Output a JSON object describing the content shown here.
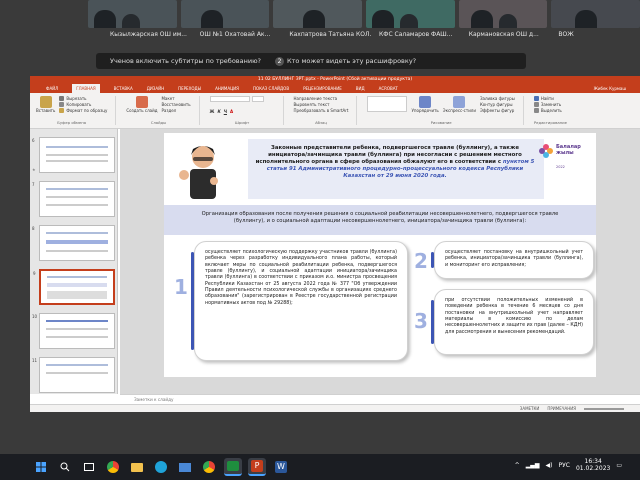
{
  "participants": {
    "names": [
      "Кызылжарская ОШ им...",
      "ОШ №1 Охатовай Ак...",
      "Кахпатрова Татьяна КОЛ...",
      "КФС Саламаров ФАШ...",
      "Кармановская ОШ д...",
      "ВОЖ"
    ],
    "caption_prompt": "Ученов включить субтитры по требованию?",
    "caption_num": "2",
    "caption_question": "Кто может видеть эту расшифровку?"
  },
  "window": {
    "title": "11 02 БУЛЛИНГ ЗРТ.pptx - PowerPoint (Сбой активации продукта)",
    "user": "Жибек Курмаш",
    "menu": [
      "ФАЙЛ",
      "ГЛАВНАЯ",
      "ВСТАВКА",
      "ДИЗАЙН",
      "ПЕРЕХОДЫ",
      "АНИМАЦИЯ",
      "ПОКАЗ СЛАЙДОВ",
      "РЕЦЕНЗИРОВАНИЕ",
      "ВИД",
      "ACROBAT"
    ],
    "ribbon": {
      "paste": "Вставить",
      "cut": "Вырезать",
      "copy": "Копировать",
      "format_painter": "Формат по образцу",
      "clipboard_label": "Буфер обмена",
      "new_slide": "Создать слайд",
      "layout": "Макет",
      "reset": "Восстановить",
      "section": "Раздел",
      "slides_label": "Слайды",
      "font_label": "Шрифт",
      "text_direction": "Направление текста",
      "align_text": "Выровнять текст",
      "smartart": "Преобразовать в SmartArt",
      "paragraph_label": "Абзац",
      "arrange": "Упорядочить",
      "quick_styles": "Экспресс-стили",
      "fill": "Заливка фигуры",
      "outline": "Контур фигуры",
      "effects": "Эффекты фигур",
      "drawing_label": "Рисование",
      "find": "Найти",
      "replace": "Заменить",
      "select": "Выделить",
      "editing_label": "Редактирование"
    }
  },
  "slide_numbers": [
    "6",
    "7",
    "8",
    "9",
    "10",
    "11"
  ],
  "slide": {
    "title_plain_1": "Законные представители ребенка, подвергшегося травле (буллингу), а также инициатора/зачинщика травли (буллинга) при несогласии с решением местного исполнительного органа в сфере образования обжалуют его в соответствии с ",
    "title_highlight": "пунктом 5 статьи 91 Административного процедурно-процессуального кодекса Республики Казахстан от 29 июня 2020 года.",
    "logo_line1": "Балалар",
    "logo_line2": "жылы",
    "logo_year": "2022",
    "banner": "Организация образования после получения решения о социальной реабилитации несовершеннолетнего, подвергшегося травле (буллингу), и о социальной адаптации несовершеннолетнего, инициатора/зачинщика травли (буллинга):",
    "num1": "1",
    "num2": "2",
    "num3": "3",
    "card1": "осуществляет психологическую поддержку участников травли (буллинга) ребенка через разработку индивидуального плана работы, который включает меры по социальной реабилитации ребенка, подвергшегося травле (буллингу), и социальной адаптации инициатора/зачинщика травли (буллинга) в соответствии с приказом и.о. министра просвещения Республики Казахстан от 25 августа 2022 года № 377 \"Об утверждении Правил деятельности психологической службы в организациях среднего образования\" (зарегистрирован в Реестре государственной регистрации нормативных актов под № 29288);",
    "card2": "осуществляет постановку на внутришкольный учет ребенка, инициатора/зачинщика травли (буллинга), и мониторинг его исправления;",
    "card3": "при отсутствии положительных изменений в поведении ребенка в течение 6 месяцев со дня постановки на внутришкольный учет направляет материалы в комиссию по делам несовершеннолетних и защите их прав (далее – КДН) для рассмотрения и вынесения рекомендаций."
  },
  "notes_placeholder": "Заметки к слайду",
  "status": {
    "notes": "ЗАМЕТКИ",
    "comments": "ПРИМЕЧАНИЯ"
  },
  "taskbar": {
    "search_placeholder": "",
    "lang": "РУС",
    "time": "16:34",
    "date": "01.02.2023"
  },
  "colors": {
    "accent": "#c43e1c",
    "slide_blue": "#3c55b4",
    "banner": "#d8dcef"
  }
}
